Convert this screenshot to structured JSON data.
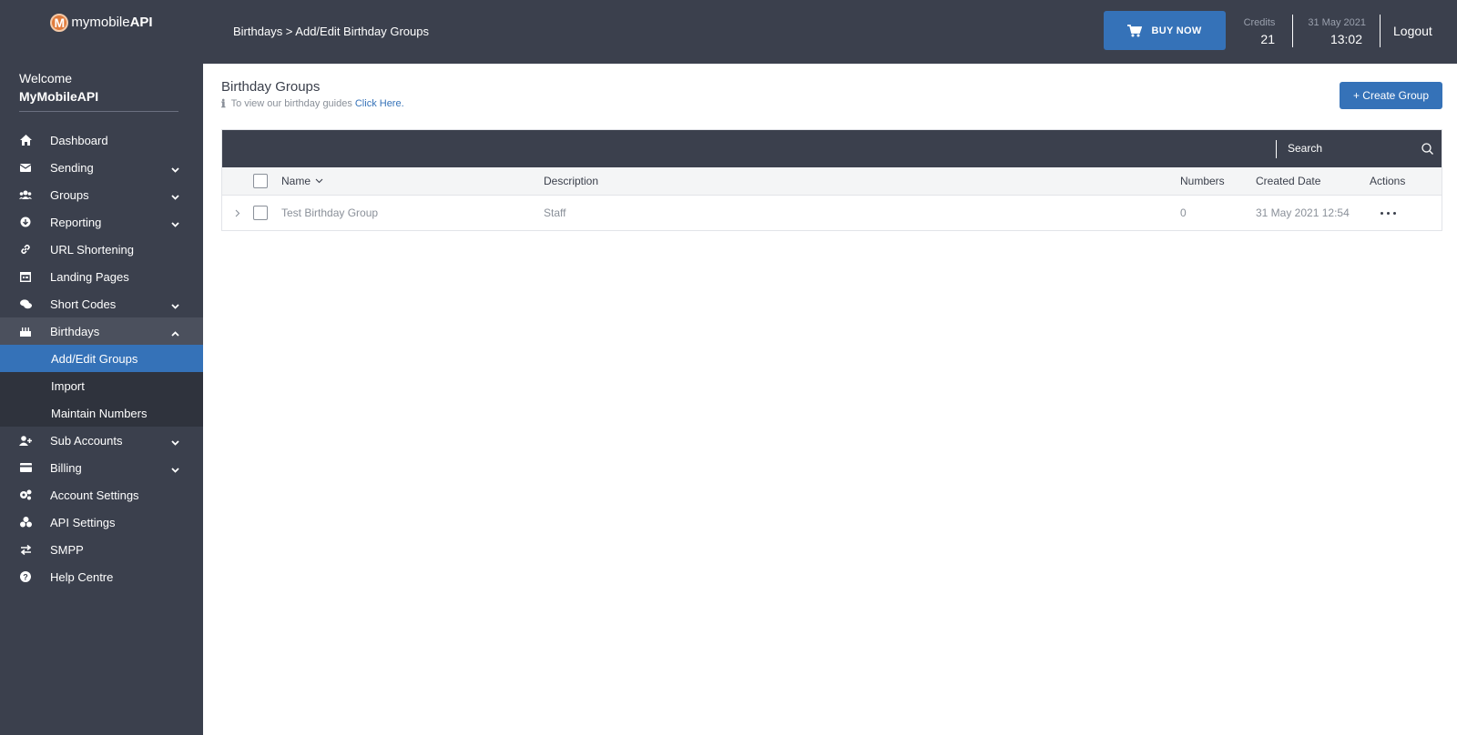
{
  "brand": {
    "logo_letter": "M",
    "name_light": "mymobile",
    "name_bold": "API"
  },
  "welcome": {
    "label": "Welcome",
    "user": "MyMobileAPI"
  },
  "sidebar": {
    "items": [
      {
        "label": "Dashboard",
        "icon": "home-icon"
      },
      {
        "label": "Sending",
        "icon": "envelope-icon"
      },
      {
        "label": "Groups",
        "icon": "users-icon"
      },
      {
        "label": "Reporting",
        "icon": "chart-icon"
      },
      {
        "label": "URL Shortening",
        "icon": "link-icon"
      },
      {
        "label": "Landing Pages",
        "icon": "page-icon"
      },
      {
        "label": "Short Codes",
        "icon": "comments-icon"
      },
      {
        "label": "Birthdays",
        "icon": "cake-icon"
      },
      {
        "label": "Sub Accounts",
        "icon": "user-plus-icon"
      },
      {
        "label": "Billing",
        "icon": "credit-card-icon"
      },
      {
        "label": "Account Settings",
        "icon": "cogs-icon"
      },
      {
        "label": "API Settings",
        "icon": "api-icon"
      },
      {
        "label": "SMPP",
        "icon": "exchange-icon"
      },
      {
        "label": "Help Centre",
        "icon": "question-icon"
      }
    ],
    "birthdays_sub": [
      {
        "label": "Add/Edit Groups"
      },
      {
        "label": "Import"
      },
      {
        "label": "Maintain Numbers"
      }
    ]
  },
  "topbar": {
    "breadcrumb": "Birthdays > Add/Edit Birthday Groups",
    "buy_label": "BUY NOW",
    "credits_label": "Credits",
    "credits_value": "21",
    "date": "31 May 2021",
    "time": "13:02",
    "logout": "Logout"
  },
  "page": {
    "title": "Birthday Groups",
    "guide_text": "To view our birthday guides",
    "guide_link": "Click Here.",
    "create_label": "+ Create Group"
  },
  "table": {
    "search_placeholder": "Search",
    "columns": {
      "name": "Name",
      "description": "Description",
      "numbers": "Numbers",
      "created": "Created Date",
      "actions": "Actions"
    },
    "rows": [
      {
        "name": "Test Birthday Group",
        "description": "Staff",
        "numbers": "0",
        "created": "31 May 2021 12:54"
      }
    ]
  },
  "colors": {
    "sidebar": "#3b404d",
    "accent": "#3572b8",
    "submenu": "#2f333d"
  }
}
